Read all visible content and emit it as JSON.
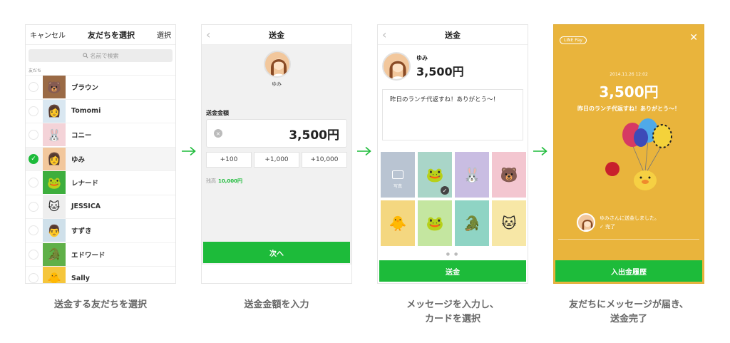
{
  "screen1": {
    "cancel": "キャンセル",
    "title": "友だちを選択",
    "select": "選択",
    "search_placeholder": "名前で検索",
    "section": "友だち",
    "friends": [
      {
        "name": "ブラウン",
        "selected": false
      },
      {
        "name": "Tomomi",
        "selected": false
      },
      {
        "name": "コニー",
        "selected": false
      },
      {
        "name": "ゆみ",
        "selected": true
      },
      {
        "name": "レナード",
        "selected": false
      },
      {
        "name": "JESSICA",
        "selected": false
      },
      {
        "name": "すずき",
        "selected": false
      },
      {
        "name": "エドワード",
        "selected": false
      },
      {
        "name": "Sally",
        "selected": false
      }
    ]
  },
  "screen2": {
    "title": "送金",
    "recipient": "ゆみ",
    "amount_label": "送金金額",
    "amount": "3,500円",
    "quick": [
      "+100",
      "+1,000",
      "+10,000"
    ],
    "balance_label": "残高",
    "balance": "10,000円",
    "next": "次へ"
  },
  "screen3": {
    "title": "送金",
    "recipient": "ゆみ",
    "amount": "3,500円",
    "message": "昨日のランチ代返すね！ありがとう〜！",
    "photo_label": "写真",
    "send": "送金"
  },
  "screen4": {
    "badge": "LINE Pay",
    "date": "2014.11.26 12:02",
    "amount": "3,500円",
    "message": "昨日のランチ代返すね！ありがとう〜！",
    "notice": "ゆみさんに送金しました。",
    "status": "✓ 完了",
    "history": "入出金履歴"
  },
  "captions": {
    "c1": "送金する友だちを選択",
    "c2": "送金金額を入力",
    "c3_line1": "メッセージを入力し、",
    "c3_line2": "カードを選択",
    "c4_line1": "友だちにメッセージが届き、",
    "c4_line2": "送金完了"
  },
  "colors": {
    "green": "#1dbb3a",
    "pay_orange": "#e9b43c"
  }
}
